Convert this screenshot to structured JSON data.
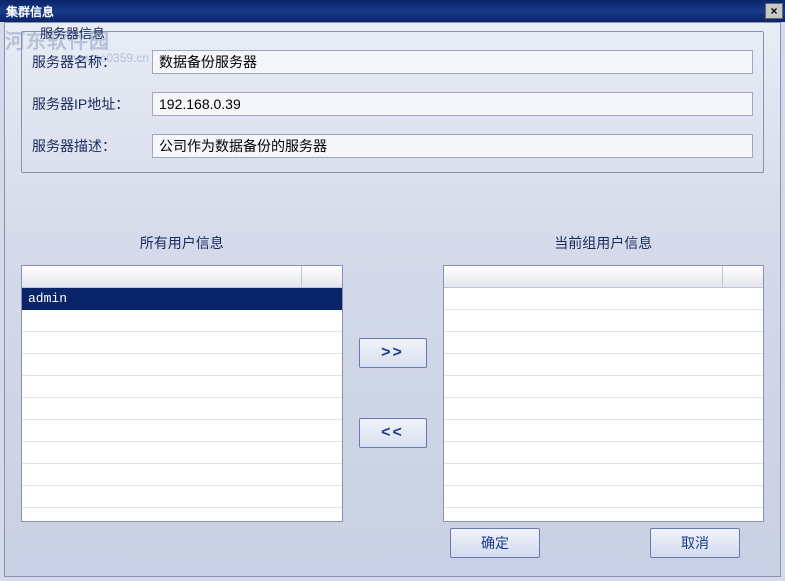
{
  "title": "集群信息",
  "watermark": {
    "text": "河东软件园",
    "url": "www.pc0359.cn"
  },
  "fieldset_legend": "服务器信息",
  "fields": {
    "name": {
      "label": "服务器名称：",
      "value": "数据备份服务器"
    },
    "ip": {
      "label": "服务器IP地址：",
      "value": "192.168.0.39"
    },
    "desc": {
      "label": "服务器描述：",
      "value": "公司作为数据备份的服务器"
    }
  },
  "lists": {
    "all": {
      "header": "所有用户信息",
      "items": [
        "admin"
      ],
      "selected_index": 0
    },
    "current": {
      "header": "当前组用户信息",
      "items": []
    }
  },
  "buttons": {
    "move_right": ">>",
    "move_left": "<<",
    "ok": "确定",
    "cancel": "取消"
  }
}
